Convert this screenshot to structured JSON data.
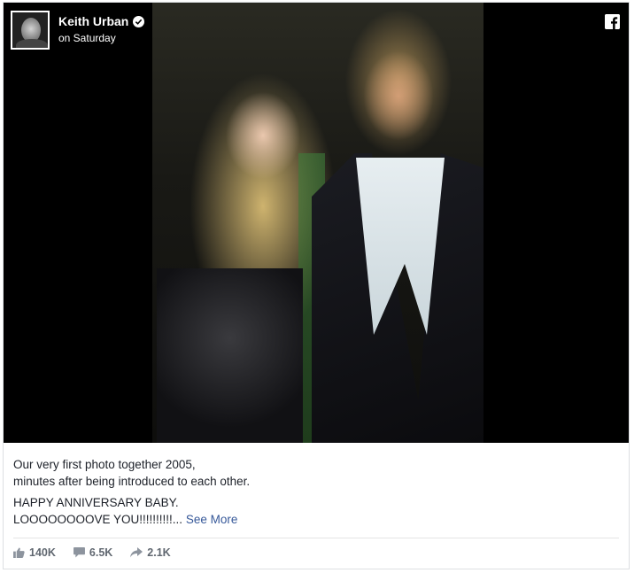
{
  "post": {
    "author": "Keith Urban",
    "timestamp": "on Saturday",
    "caption_line1": "Our very first photo together 2005,",
    "caption_line2": "minutes after being introduced to each other.",
    "caption_line3": "HAPPY ANNIVERSARY BABY.",
    "caption_line4_text": "LOOOOOOOOVE YOU!!!!!!!!!!...",
    "see_more": "See More"
  },
  "stats": {
    "likes": "140K",
    "comments": "6.5K",
    "shares": "2.1K"
  },
  "icons": {
    "verified": "verified-badge-icon",
    "brand": "facebook-icon",
    "like": "thumbs-up-icon",
    "comment": "comment-bubble-icon",
    "share": "share-arrow-icon"
  },
  "colors": {
    "link": "#365899",
    "media_background": "#000000",
    "stats_text": "#606770"
  }
}
